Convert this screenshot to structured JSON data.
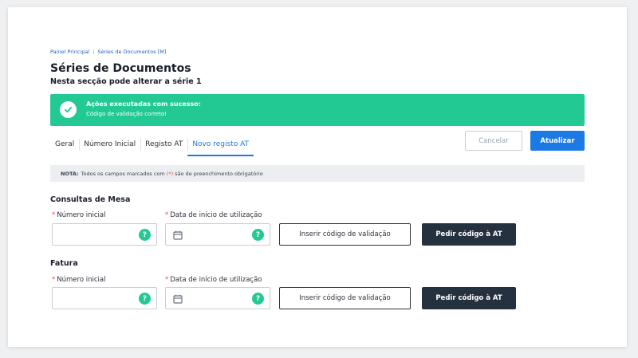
{
  "breadcrumb": {
    "items": [
      "Painel Principal",
      "Séries de Documentos [M]"
    ],
    "separator": "|"
  },
  "page": {
    "title": "Séries de Documentos",
    "subtitle": "Nesta secção pode alterar a série 1"
  },
  "alert": {
    "heading": "Ações executadas com sucesso:",
    "message": "Código de validação correto!",
    "color": "#22c993",
    "icon": "check-circle-icon"
  },
  "tabs": [
    {
      "label": "Geral",
      "active": false
    },
    {
      "label": "Número Inicial",
      "active": false
    },
    {
      "label": "Registo AT",
      "active": false
    },
    {
      "label": "Novo registo AT",
      "active": true
    }
  ],
  "actions": {
    "cancel_label": "Cancelar",
    "update_label": "Atualizar",
    "accent": "#1b7ae6"
  },
  "note": {
    "label": "NOTA:",
    "text_before": "Todos os campos marcados com",
    "required_marker": "(*)",
    "text_after": "são de preenchimento obrigatório"
  },
  "sections": [
    {
      "title": "Consultas de Mesa",
      "initial_number_label": "Número inicial",
      "initial_number_value": "",
      "start_date_label": "Data de início de utilização",
      "start_date_value": "",
      "validation_button": "Inserir código de validação",
      "request_button": "Pedir código à AT"
    },
    {
      "title": "Fatura",
      "initial_number_label": "Número inicial",
      "initial_number_value": "",
      "start_date_label": "Data de início de utilização",
      "start_date_value": "",
      "validation_button": "Inserir código de validação",
      "request_button": "Pedir código à AT"
    }
  ],
  "required_asterisk": "*",
  "help_glyph": "?"
}
